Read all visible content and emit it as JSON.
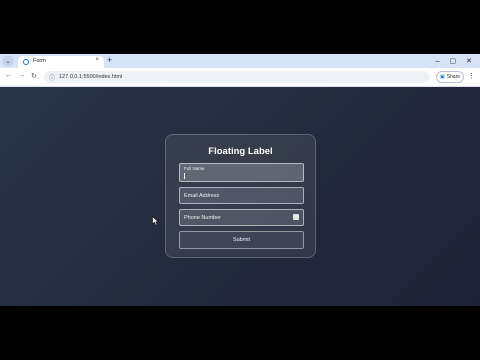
{
  "browser": {
    "tab_title": "Form",
    "tab_close": "×",
    "new_tab": "+",
    "tab_menu": "⌄",
    "window_buttons": [
      "–",
      "▢",
      "✕"
    ],
    "nav": {
      "back": "←",
      "forward": "→",
      "reload": "↻"
    },
    "url": "127.0.0.1:5500/index.html",
    "site_icon": "ⓘ",
    "share_label": "Share",
    "kebab": "⋮"
  },
  "form": {
    "title": "Floating Label",
    "fields": [
      {
        "label": "Full Name",
        "value": "",
        "focused": true
      },
      {
        "label": "Email Address",
        "value": ""
      },
      {
        "label": "Phone Number",
        "value": "",
        "icon": "autofill-card-icon"
      }
    ],
    "submit_label": "Submit"
  },
  "colors": {
    "page_bg": "#24293a",
    "card_border": "#ffffff",
    "text": "#ffffff"
  }
}
